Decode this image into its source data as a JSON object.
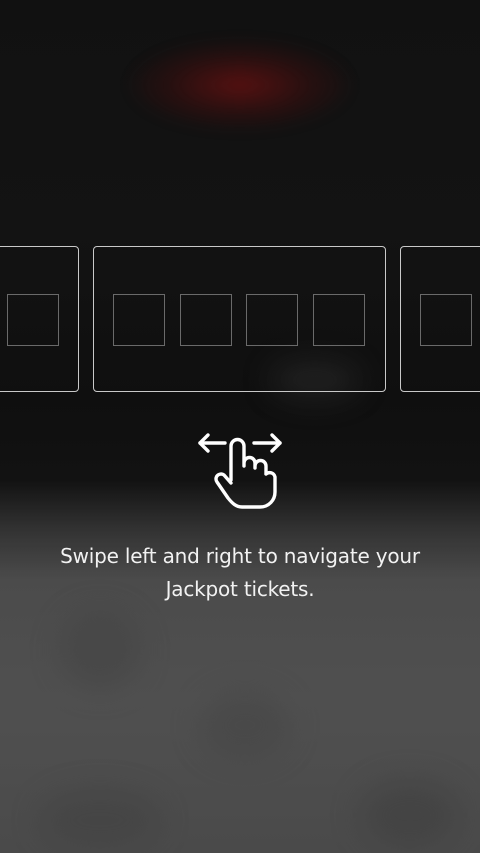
{
  "onboarding": {
    "instruction_line1": "Swipe left and right to navigate your",
    "instruction_line2": "Jackpot tickets.",
    "gesture_icon": "swipe-hand-icon"
  },
  "tickets": {
    "visible_count": 3,
    "slots_per_ticket": 4
  },
  "colors": {
    "ticket_border": "#c9c9c9",
    "slot_border": "#6a6a6a",
    "text": "#f2f2f2",
    "accent_glow": "#8c1414"
  }
}
